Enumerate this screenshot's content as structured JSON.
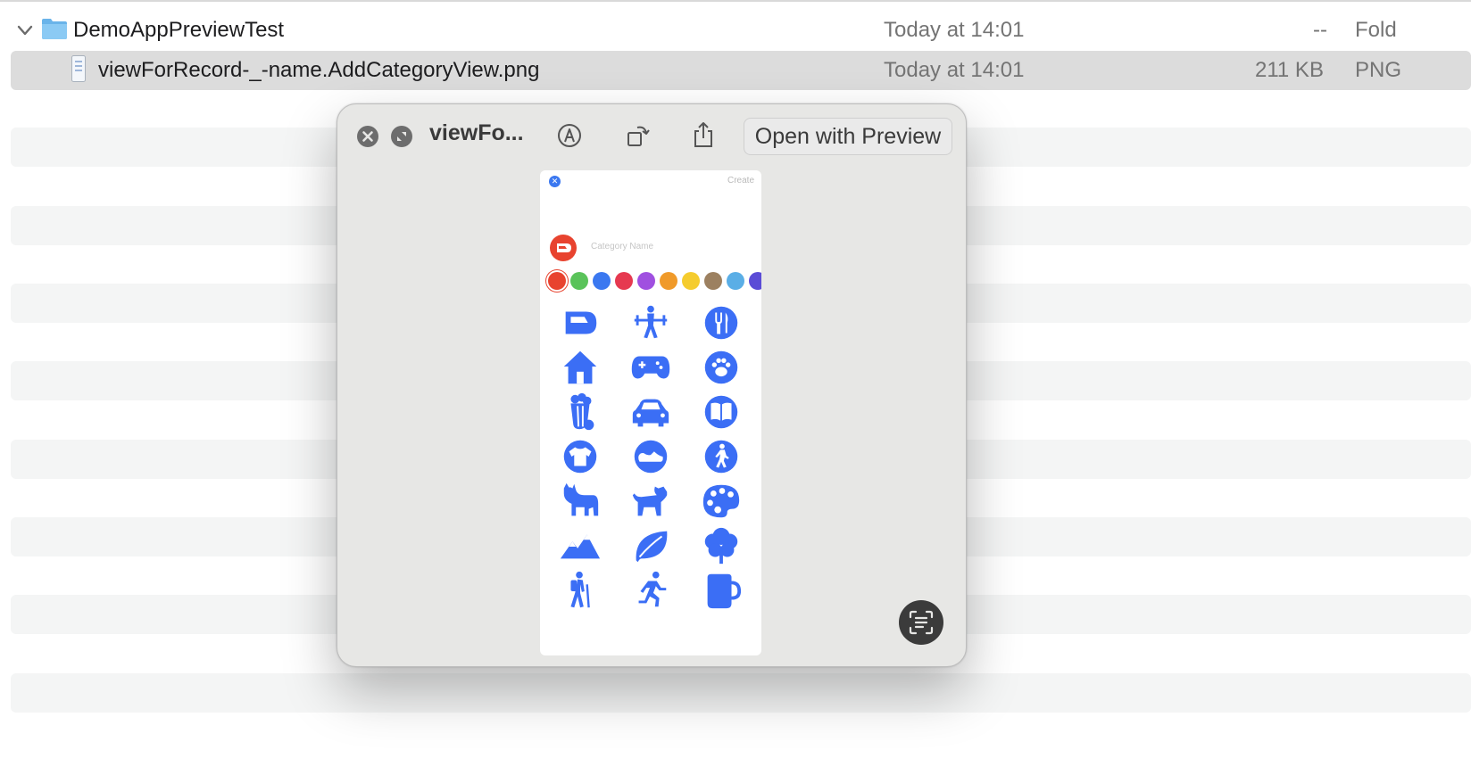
{
  "finder": {
    "folder_row": {
      "name": "DemoAppPreviewTest",
      "date": "Today at 14:01",
      "size": "--",
      "kind": "Fold"
    },
    "file_row": {
      "name": "viewForRecord-_-name.AddCategoryView.png",
      "date": "Today at 14:01",
      "size": "211 KB",
      "kind": "PNG"
    }
  },
  "quicklook": {
    "title": "viewFo...",
    "open_with_label": "Open with Preview"
  },
  "preview": {
    "create_label": "Create",
    "category_placeholder": "Category Name",
    "close_glyph": "✕",
    "swatch_colors": [
      "#e8432f",
      "#5ac35a",
      "#3b78f0",
      "#e63950",
      "#a050e0",
      "#f09a2a",
      "#f5cc2e",
      "#9c8060",
      "#5aaee6",
      "#5b4cd6"
    ],
    "icon_color": "#3b6ef5",
    "icons": [
      "train-icon",
      "weightlifting-icon",
      "fork-knife-icon",
      "house-icon",
      "gamecontroller-icon",
      "pawprint-icon",
      "popcorn-icon",
      "car-icon",
      "book-icon",
      "tshirt-icon",
      "shoe-icon",
      "figure-walk-icon",
      "cat-icon",
      "dog-icon",
      "paintpalette-icon",
      "mountains-icon",
      "leaf-icon",
      "tree-icon",
      "figure-hiking-icon",
      "figure-run-icon",
      "mug-icon"
    ]
  }
}
